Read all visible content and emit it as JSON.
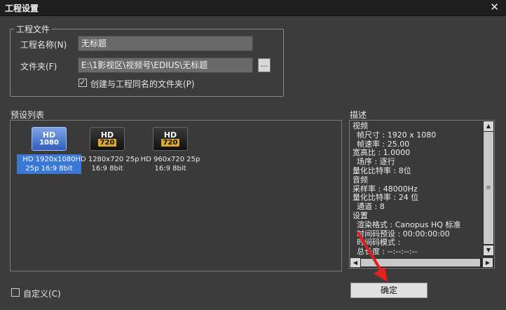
{
  "window": {
    "title": "工程设置",
    "close_glyph": "✕"
  },
  "project_file": {
    "group_label": "工程文件",
    "name_label": "工程名称(N)",
    "name_value": "无标题",
    "folder_label": "文件夹(F)",
    "folder_value": "E:\\1影视区\\视频号\\EDIUS\\无标题",
    "browse_label": "...",
    "create_folder_checked": true,
    "create_folder_label": "创建与工程同名的文件夹(P)"
  },
  "preset_list": {
    "label": "预设列表",
    "items": [
      {
        "icon_top": "HD",
        "icon_bottom": "1080",
        "caption1": "HD 1920x1080",
        "caption2": "25p 16:9 8bit",
        "selected": true,
        "icon_color": "blue",
        "icon": "hd-1080-icon"
      },
      {
        "icon_top": "HD",
        "icon_bottom": "720",
        "caption1": "HD 1280x720 25p",
        "caption2": "16:9 8bit",
        "selected": false,
        "icon_color": "dark",
        "icon": "hd-720-icon"
      },
      {
        "icon_top": "HD",
        "icon_bottom": "720",
        "caption1": "HD 960x720 25p",
        "caption2": "16:9 8bit",
        "selected": false,
        "icon_color": "dark",
        "icon": "hd-720-icon"
      }
    ]
  },
  "description": {
    "label": "描述",
    "lines": [
      {
        "text": "视频",
        "indent": false
      },
      {
        "text": "帧尺寸 : 1920 x 1080",
        "indent": true
      },
      {
        "text": "帧速率 : 25.00",
        "indent": true
      },
      {
        "text": "宽高比 : 1.0000",
        "indent": false
      },
      {
        "text": "场序 : 逐行",
        "indent": true
      },
      {
        "text": "量化比特率 : 8位",
        "indent": false
      },
      {
        "text": "音频",
        "indent": false
      },
      {
        "text": "采样率 : 48000Hz",
        "indent": false
      },
      {
        "text": "量化比特率 : 24 位",
        "indent": false
      },
      {
        "text": "通道 : 8",
        "indent": true
      },
      {
        "text": "设置",
        "indent": false
      },
      {
        "text": "渲染格式 : Canopus HQ 标准",
        "indent": true
      },
      {
        "text": "时间码预设 : 00:00:00:00",
        "indent": true
      },
      {
        "text": "时间码模式 :",
        "indent": true
      },
      {
        "text": "总长度 : --:--:--:--",
        "indent": true
      }
    ]
  },
  "custom": {
    "checked": false,
    "label": "自定义(C)"
  },
  "ok_button": {
    "label": "确定"
  },
  "colors": {
    "background": "#3c3c3c",
    "titlebar": "#1e1e1e",
    "selection": "#3b78d6",
    "annotation_arrow": "#e02020"
  }
}
